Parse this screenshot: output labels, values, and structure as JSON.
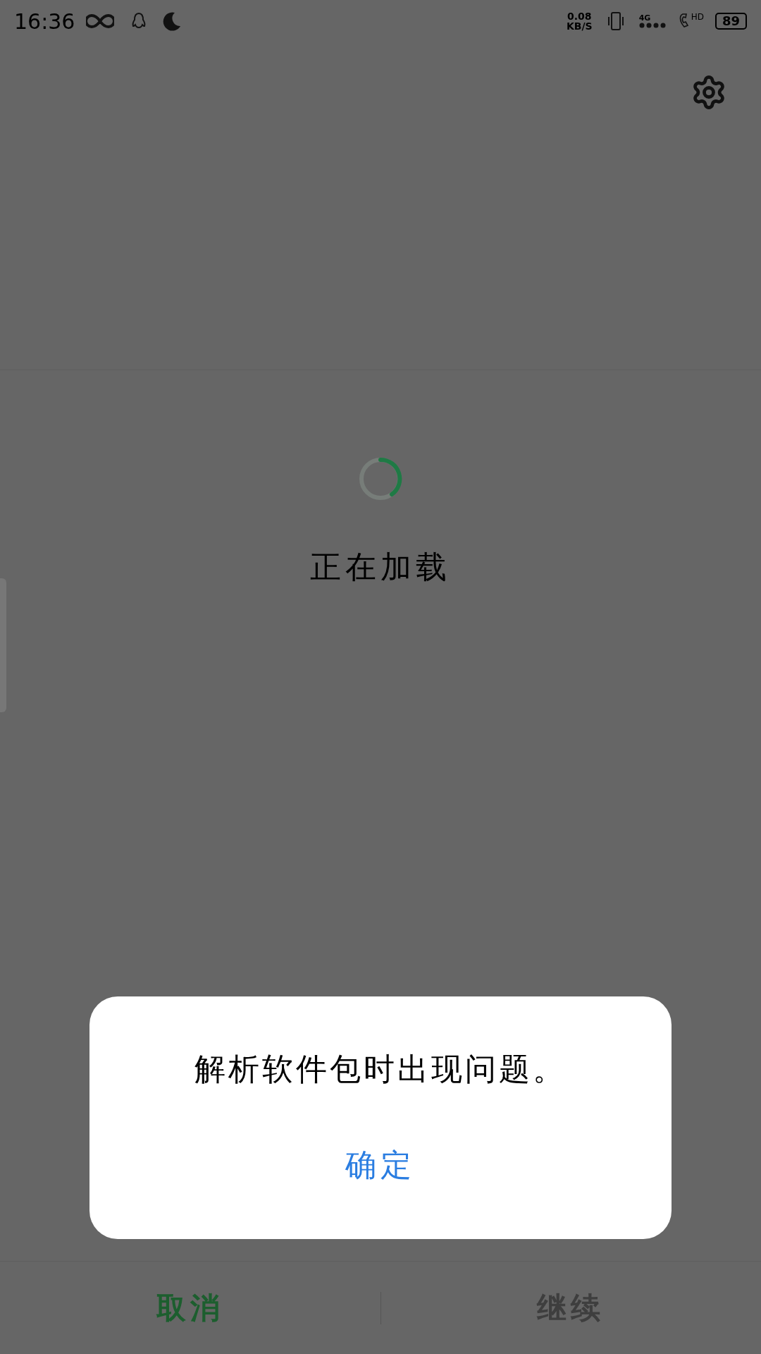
{
  "status_bar": {
    "time": "16:36",
    "net_speed_value": "0.08",
    "net_speed_unit": "KB/S",
    "network_type": "4G",
    "hd_label": "HD",
    "battery": "89"
  },
  "loading": {
    "text": "正在加载"
  },
  "dialog": {
    "message": "解析软件包时出现问题。",
    "button": "确定"
  },
  "bottom_buttons": [
    {
      "label": "取消",
      "disabled": false
    },
    {
      "label": "继续",
      "disabled": true
    }
  ]
}
